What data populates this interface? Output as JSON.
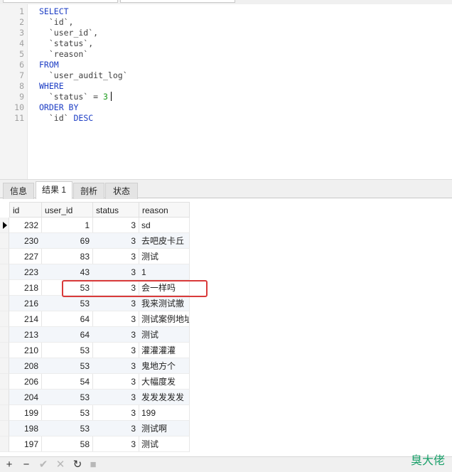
{
  "editor": {
    "lines": [
      {
        "n": "1",
        "parts": [
          {
            "t": "SELECT",
            "c": "kw"
          }
        ]
      },
      {
        "n": "2",
        "parts": [
          {
            "t": "  `id`,",
            "c": ""
          }
        ]
      },
      {
        "n": "3",
        "parts": [
          {
            "t": "  `user_id`,",
            "c": ""
          }
        ]
      },
      {
        "n": "4",
        "parts": [
          {
            "t": "  `status`,",
            "c": ""
          }
        ]
      },
      {
        "n": "5",
        "parts": [
          {
            "t": "  `reason`",
            "c": ""
          }
        ]
      },
      {
        "n": "6",
        "parts": [
          {
            "t": "FROM",
            "c": "kw"
          }
        ]
      },
      {
        "n": "7",
        "parts": [
          {
            "t": "  `user_audit_log`",
            "c": ""
          }
        ]
      },
      {
        "n": "8",
        "parts": [
          {
            "t": "WHERE",
            "c": "kw"
          }
        ]
      },
      {
        "n": "9",
        "parts": [
          {
            "t": "  `status` = ",
            "c": ""
          },
          {
            "t": "3",
            "c": "num"
          }
        ],
        "cursor": true
      },
      {
        "n": "10",
        "parts": [
          {
            "t": "ORDER BY",
            "c": "kw"
          }
        ]
      },
      {
        "n": "11",
        "parts": [
          {
            "t": "  `id` ",
            "c": ""
          },
          {
            "t": "DESC",
            "c": "kw"
          }
        ]
      }
    ]
  },
  "tabs": [
    {
      "label": "信息",
      "active": false
    },
    {
      "label": "结果 1",
      "active": true
    },
    {
      "label": "剖析",
      "active": false
    },
    {
      "label": "状态",
      "active": false
    }
  ],
  "results": {
    "columns": [
      "id",
      "user_id",
      "status",
      "reason"
    ],
    "rows": [
      [
        "232",
        "1",
        "3",
        "sd"
      ],
      [
        "230",
        "69",
        "3",
        "去吧皮卡丘"
      ],
      [
        "227",
        "83",
        "3",
        "测试"
      ],
      [
        "223",
        "43",
        "3",
        "1"
      ],
      [
        "218",
        "53",
        "3",
        "会一样吗"
      ],
      [
        "216",
        "53",
        "3",
        "我来测试撤"
      ],
      [
        "214",
        "64",
        "3",
        "测试案例地址"
      ],
      [
        "213",
        "64",
        "3",
        "测试"
      ],
      [
        "210",
        "53",
        "3",
        "灌灌灌灌"
      ],
      [
        "208",
        "53",
        "3",
        "鬼地方个"
      ],
      [
        "206",
        "54",
        "3",
        "大幅度发"
      ],
      [
        "204",
        "53",
        "3",
        "发发发发发"
      ],
      [
        "199",
        "53",
        "3",
        "199"
      ],
      [
        "198",
        "53",
        "3",
        "测试啊"
      ],
      [
        "197",
        "58",
        "3",
        "测试"
      ]
    ],
    "current_row": 0,
    "highlighted_row": 4
  },
  "bottom_toolbar": {
    "buttons": [
      {
        "name": "add-record-button",
        "glyph": "+",
        "enabled": true
      },
      {
        "name": "delete-record-button",
        "glyph": "−",
        "enabled": true
      },
      {
        "name": "apply-changes-button",
        "glyph": "✔",
        "enabled": false
      },
      {
        "name": "discard-changes-button",
        "glyph": "✕",
        "enabled": false
      },
      {
        "name": "refresh-button",
        "glyph": "↻",
        "enabled": true
      },
      {
        "name": "stop-button",
        "glyph": "■",
        "enabled": false
      }
    ]
  },
  "watermark": "臭大佬"
}
